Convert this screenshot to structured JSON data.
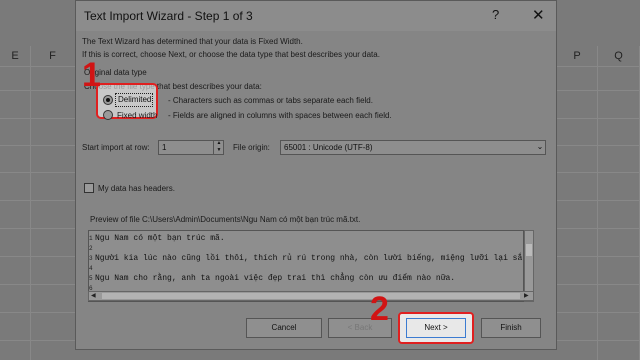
{
  "sheet": {
    "columns": [
      "E",
      "F",
      "P",
      "Q"
    ]
  },
  "dialog": {
    "title": "Text Import Wizard - Step 1 of 3",
    "help_icon": "?",
    "close_icon": "✕",
    "intro_line1": "The Text Wizard has determined that your data is Fixed Width.",
    "intro_line2": "If this is correct, choose Next, or choose the data type that best describes your data.",
    "section_label": "Original data type",
    "choose_label": "Choose the file type that best describes your data:",
    "options": [
      {
        "label": "Delimited",
        "desc": "- Characters such as commas or tabs separate each field.",
        "selected": true
      },
      {
        "label": "Fixed width",
        "desc": "- Fields are aligned in columns with spaces between each field.",
        "selected": false
      }
    ],
    "start_row_label": "Start import at row:",
    "start_row_value": "1",
    "file_origin_label": "File origin:",
    "file_origin_value": "65001 : Unicode (UTF-8)",
    "headers_label": "My data has headers.",
    "preview_label": "Preview of file C:\\Users\\Admin\\Documents\\Ngu Nam có một bạn trúc mã.txt.",
    "preview_rows": [
      {
        "num": "1",
        "text": "Ngu Nam có một bạn trúc mã."
      },
      {
        "num": "2",
        "text": ""
      },
      {
        "num": "3",
        "text": "Người kia lúc nào cũng lồi thôi, thích rủ rú trong nhà, còn lười biếng, miệng lưỡi lại sắ"
      },
      {
        "num": "4",
        "text": ""
      },
      {
        "num": "5",
        "text": "Ngu Nam cho rằng, anh ta ngoài việc đẹp trai thì chẳng còn ưu điểm nào nữa."
      },
      {
        "num": "6",
        "text": ""
      }
    ],
    "buttons": {
      "cancel": "Cancel",
      "back": "< Back",
      "next": "Next >",
      "finish": "Finish"
    }
  },
  "annotations": {
    "step1": "1",
    "step2": "2"
  },
  "colors": {
    "highlight": "#e02020",
    "overlay": "#808080"
  }
}
